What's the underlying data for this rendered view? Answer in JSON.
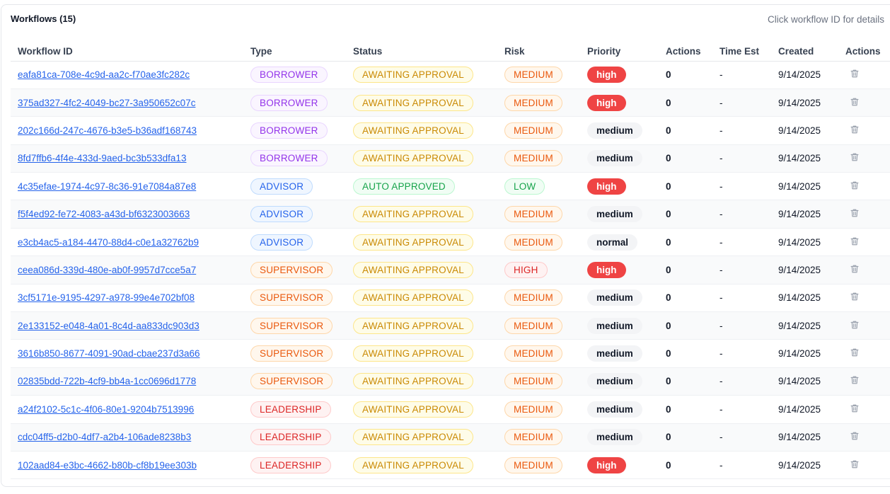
{
  "header": {
    "title": "Workflows (15)",
    "hint": "Click workflow ID for details"
  },
  "columns": [
    "Workflow ID",
    "Type",
    "Status",
    "Risk",
    "Priority",
    "Actions",
    "Time Est",
    "Created",
    "Actions"
  ],
  "colors": {
    "link": "#2563eb",
    "priority_high": "#ef4444"
  },
  "rows": [
    {
      "id": "eafa81ca-708e-4c9d-aa2c-f70ae3fc282c",
      "type": "BORROWER",
      "status": "AWAITING APPROVAL",
      "risk": "MEDIUM",
      "priority": "high",
      "actions": "0",
      "time_est": "-",
      "created": "9/14/2025"
    },
    {
      "id": "375ad327-4fc2-4049-bc27-3a950652c07c",
      "type": "BORROWER",
      "status": "AWAITING APPROVAL",
      "risk": "MEDIUM",
      "priority": "high",
      "actions": "0",
      "time_est": "-",
      "created": "9/14/2025"
    },
    {
      "id": "202c166d-247c-4676-b3e5-b36adf168743",
      "type": "BORROWER",
      "status": "AWAITING APPROVAL",
      "risk": "MEDIUM",
      "priority": "medium",
      "actions": "0",
      "time_est": "-",
      "created": "9/14/2025"
    },
    {
      "id": "8fd7ffb6-4f4e-433d-9aed-bc3b533dfa13",
      "type": "BORROWER",
      "status": "AWAITING APPROVAL",
      "risk": "MEDIUM",
      "priority": "medium",
      "actions": "0",
      "time_est": "-",
      "created": "9/14/2025"
    },
    {
      "id": "4c35efae-1974-4c97-8c36-91e7084a87e8",
      "type": "ADVISOR",
      "status": "AUTO APPROVED",
      "risk": "LOW",
      "priority": "high",
      "actions": "0",
      "time_est": "-",
      "created": "9/14/2025"
    },
    {
      "id": "f5f4ed92-fe72-4083-a43d-bf6323003663",
      "type": "ADVISOR",
      "status": "AWAITING APPROVAL",
      "risk": "MEDIUM",
      "priority": "medium",
      "actions": "0",
      "time_est": "-",
      "created": "9/14/2025"
    },
    {
      "id": "e3cb4ac5-a184-4470-88d4-c0e1a32762b9",
      "type": "ADVISOR",
      "status": "AWAITING APPROVAL",
      "risk": "MEDIUM",
      "priority": "normal",
      "actions": "0",
      "time_est": "-",
      "created": "9/14/2025"
    },
    {
      "id": "ceea086d-339d-480e-ab0f-9957d7cce5a7",
      "type": "SUPERVISOR",
      "status": "AWAITING APPROVAL",
      "risk": "HIGH",
      "priority": "high",
      "actions": "0",
      "time_est": "-",
      "created": "9/14/2025"
    },
    {
      "id": "3cf5171e-9195-4297-a978-99e4e702bf08",
      "type": "SUPERVISOR",
      "status": "AWAITING APPROVAL",
      "risk": "MEDIUM",
      "priority": "medium",
      "actions": "0",
      "time_est": "-",
      "created": "9/14/2025"
    },
    {
      "id": "2e133152-e048-4a01-8c4d-aa833dc903d3",
      "type": "SUPERVISOR",
      "status": "AWAITING APPROVAL",
      "risk": "MEDIUM",
      "priority": "medium",
      "actions": "0",
      "time_est": "-",
      "created": "9/14/2025"
    },
    {
      "id": "3616b850-8677-4091-90ad-cbae237d3a66",
      "type": "SUPERVISOR",
      "status": "AWAITING APPROVAL",
      "risk": "MEDIUM",
      "priority": "medium",
      "actions": "0",
      "time_est": "-",
      "created": "9/14/2025"
    },
    {
      "id": "02835bdd-722b-4cf9-bb4a-1cc0696d1778",
      "type": "SUPERVISOR",
      "status": "AWAITING APPROVAL",
      "risk": "MEDIUM",
      "priority": "medium",
      "actions": "0",
      "time_est": "-",
      "created": "9/14/2025"
    },
    {
      "id": "a24f2102-5c1c-4f06-80e1-9204b7513996",
      "type": "LEADERSHIP",
      "status": "AWAITING APPROVAL",
      "risk": "MEDIUM",
      "priority": "medium",
      "actions": "0",
      "time_est": "-",
      "created": "9/14/2025"
    },
    {
      "id": "cdc04ff5-d2b0-4df7-a2b4-106ade8238b3",
      "type": "LEADERSHIP",
      "status": "AWAITING APPROVAL",
      "risk": "MEDIUM",
      "priority": "medium",
      "actions": "0",
      "time_est": "-",
      "created": "9/14/2025"
    },
    {
      "id": "102aad84-e3bc-4662-b80b-cf8b19ee303b",
      "type": "LEADERSHIP",
      "status": "AWAITING APPROVAL",
      "risk": "MEDIUM",
      "priority": "high",
      "actions": "0",
      "time_est": "-",
      "created": "9/14/2025"
    }
  ]
}
